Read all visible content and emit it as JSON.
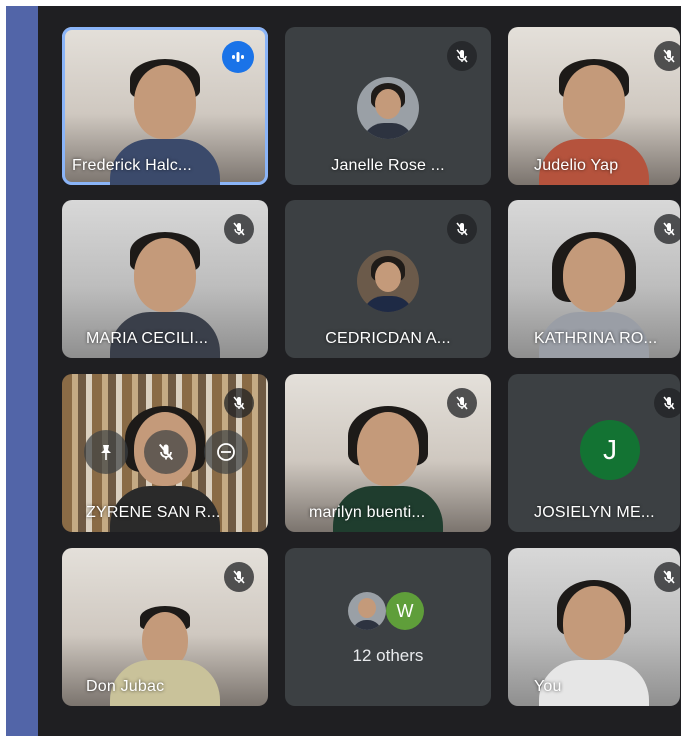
{
  "colors": {
    "frame_bg": "#1f1f22",
    "tile_bg": "#3c4043",
    "accent_strip": "#5265a8",
    "active_outline": "#8ab4f8",
    "speaking_badge": "#1a73e8",
    "avatar_green": "#137333",
    "avatar_w": "#5f9e3a"
  },
  "participants": [
    {
      "name": "Frederick Halc...",
      "speaking": true,
      "muted": false
    },
    {
      "name": "Janelle Rose ...",
      "muted": true
    },
    {
      "name": "Judelio Yap",
      "muted": true
    },
    {
      "name": "MARIA CECILI...",
      "muted": true
    },
    {
      "name": "CEDRICDAN A...",
      "muted": true
    },
    {
      "name": "KATHRINA RO...",
      "muted": true
    },
    {
      "name": "ZYRENE SAN R...",
      "muted": true
    },
    {
      "name": "marilyn buenti...",
      "muted": true
    },
    {
      "name": "JOSIELYN ME...",
      "muted": true,
      "avatar_letter": "J"
    },
    {
      "name": "Don Jubac",
      "muted": true
    },
    {
      "name": "You",
      "muted": true
    }
  ],
  "others_tile": {
    "label": "12 others",
    "mini_avatar_letter": "W"
  },
  "icons": {
    "muted": "mic-off-icon",
    "speaking": "audio-level-icon",
    "pin": "pin-icon",
    "mute_ctrl": "mic-off-icon",
    "remove": "remove-icon"
  }
}
